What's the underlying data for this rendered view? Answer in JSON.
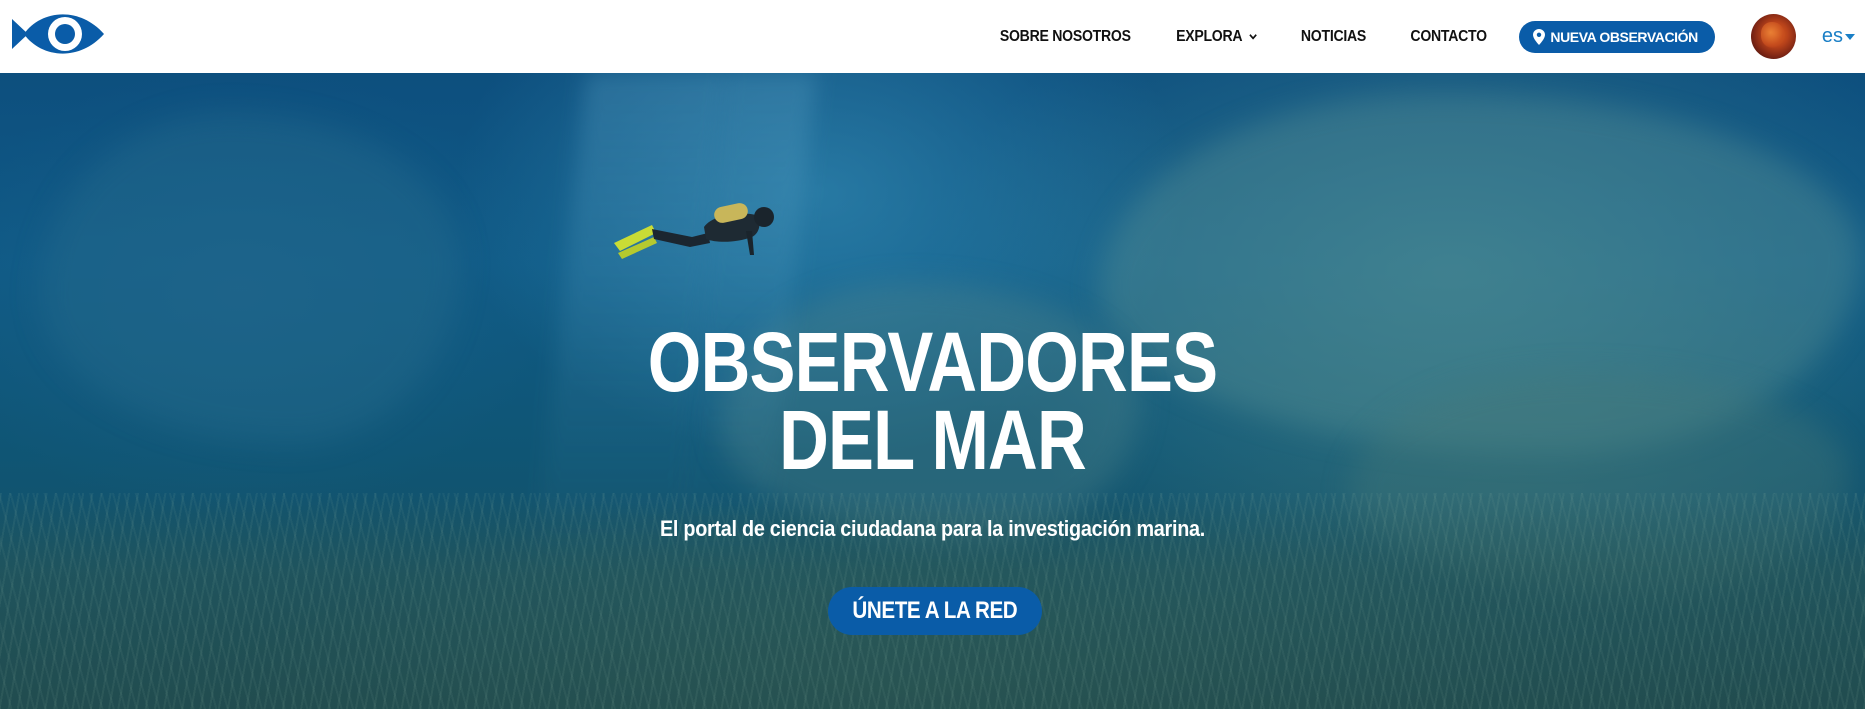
{
  "header": {
    "logo_icon": "fish-eye-logo-icon",
    "brand_color": "#0a5ca8",
    "nav": {
      "about": "SOBRE NOSOTROS",
      "explore": "EXPLORA",
      "news": "NOTICIAS",
      "contact": "CONTACTO"
    },
    "new_observation": {
      "label": "NUEVA OBSERVACIÓN",
      "icon": "map-pin-icon"
    },
    "avatar_icon": "user-avatar",
    "language": {
      "selected": "es",
      "color": "#1a7fc6"
    }
  },
  "hero": {
    "title_line1": "OBSERVADORES",
    "title_line2": "DEL MAR",
    "subtitle": "El portal de ciencia ciudadana para la investigación marina.",
    "cta_label": "ÚNETE A LA RED",
    "background": "underwater-diver-photo"
  }
}
